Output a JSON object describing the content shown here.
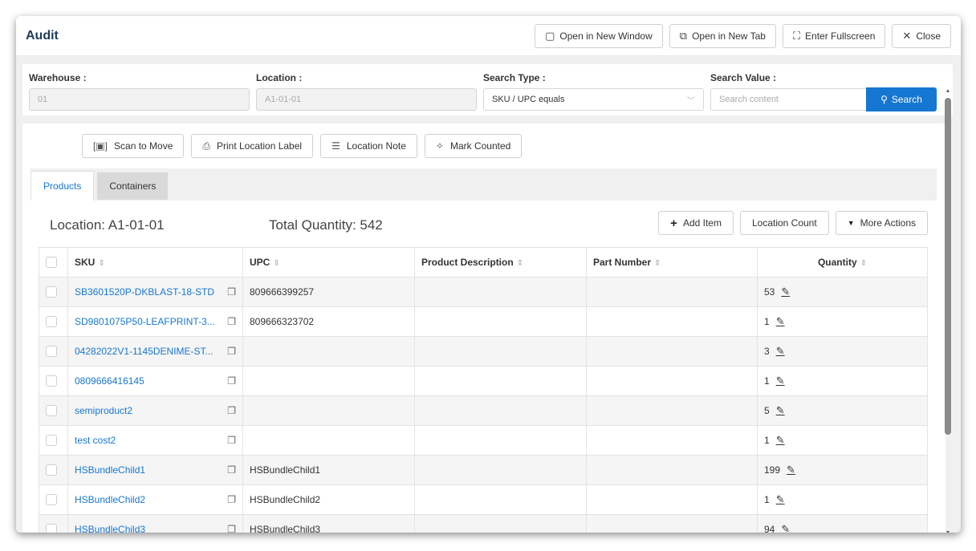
{
  "header": {
    "title": "Audit",
    "open_new_window": "Open in New Window",
    "open_new_tab": "Open in New Tab",
    "enter_fullscreen": "Enter Fullscreen",
    "close": "Close"
  },
  "filters": {
    "warehouse_label": "Warehouse :",
    "warehouse_value": "01",
    "location_label": "Location :",
    "location_value": "A1-01-01",
    "search_type_label": "Search Type :",
    "search_type_value": "SKU / UPC equals",
    "search_value_label": "Search Value :",
    "search_placeholder": "Search content",
    "search_button": "Search"
  },
  "toolbar": {
    "scan_to_move": "Scan to Move",
    "print_location_label": "Print Location Label",
    "location_note": "Location Note",
    "mark_counted": "Mark Counted"
  },
  "tabs": [
    {
      "label": "Products",
      "active": true
    },
    {
      "label": "Containers",
      "active": false
    }
  ],
  "summary": {
    "location": "Location: A1-01-01",
    "total_quantity": "Total Quantity: 542",
    "add_item": "Add Item",
    "location_count": "Location Count",
    "more_actions": "More Actions"
  },
  "table": {
    "columns": [
      "SKU",
      "UPC",
      "Product Description",
      "Part Number",
      "Quantity"
    ],
    "rows": [
      {
        "sku": "SB3601520P-DKBLAST-18-STD",
        "upc": "809666399257",
        "desc": "",
        "part": "",
        "qty": "53"
      },
      {
        "sku": "SD9801075P50-LEAFPRINT-3...",
        "upc": "809666323702",
        "desc": "",
        "part": "",
        "qty": "1"
      },
      {
        "sku": "04282022V1-1145DENIME-ST...",
        "upc": "",
        "desc": "",
        "part": "",
        "qty": "3"
      },
      {
        "sku": "0809666416145",
        "upc": "",
        "desc": "",
        "part": "",
        "qty": "1"
      },
      {
        "sku": "semiproduct2",
        "upc": "",
        "desc": "",
        "part": "",
        "qty": "5"
      },
      {
        "sku": "test cost2",
        "upc": "",
        "desc": "",
        "part": "",
        "qty": "1"
      },
      {
        "sku": "HSBundleChild1",
        "upc": "HSBundleChild1",
        "desc": "",
        "part": "",
        "qty": "199"
      },
      {
        "sku": "HSBundleChild2",
        "upc": "HSBundleChild2",
        "desc": "",
        "part": "",
        "qty": "1"
      },
      {
        "sku": "HSBundleChild3",
        "upc": "HSBundleChild3",
        "desc": "",
        "part": "",
        "qty": "94"
      }
    ]
  },
  "icons": {
    "sort": "sort-icon",
    "copy": "copy-icon",
    "edit": "edit-icon"
  }
}
